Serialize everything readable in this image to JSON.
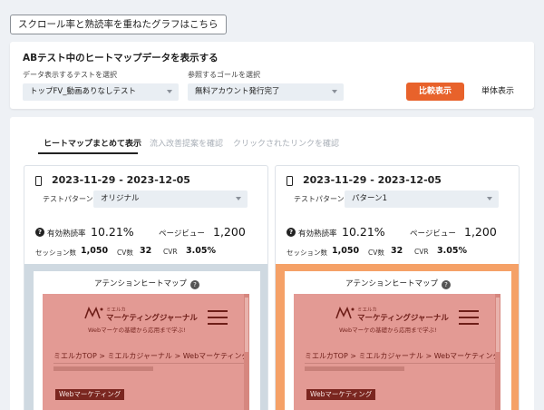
{
  "top_link": {
    "label": "スクロール率と熟読率を重ねたグラフはこちら"
  },
  "panel": {
    "title": "ABテスト中のヒートマップデータを表示する",
    "test_select_label": "データ表示するテストを選択",
    "test_select_value": "トップFV_動画ありなしテスト",
    "goal_select_label": "参照するゴールを選択",
    "goal_select_value": "無料アカウント発行完了",
    "compare_button": "比較表示",
    "single_button": "単体表示"
  },
  "tabs": [
    {
      "label": "ヒートマップまとめて表示",
      "active": true
    },
    {
      "label": "流入改善提案を確認",
      "active": false
    },
    {
      "label": "クリックされたリンクを確認",
      "active": false
    }
  ],
  "cards": [
    {
      "date_range": "2023-11-29 - 2023-12-05",
      "pattern_label": "テストパターン",
      "pattern_value": "オリジナル",
      "read_rate_label": "有効熟読率",
      "read_rate_value": "10.21%",
      "pageview_label": "ページビュー",
      "pageview_value": "1,200",
      "sessions_label": "セッション数",
      "sessions_value": "1,050",
      "cv_label": "CV数",
      "cv_value": "32",
      "cvr_label": "CVR",
      "cvr_value": "3.05%",
      "heatmap_title": "アテンションヒートマップ",
      "accent_color": "#cfd9e1"
    },
    {
      "date_range": "2023-11-29 - 2023-12-05",
      "pattern_label": "テストパターン",
      "pattern_value": "パターン1",
      "read_rate_label": "有効熟読率",
      "read_rate_value": "10.21%",
      "pageview_label": "ページビュー",
      "pageview_value": "1,200",
      "sessions_label": "セッション数",
      "sessions_value": "1,050",
      "cv_label": "CV数",
      "cv_value": "32",
      "cvr_label": "CVR",
      "cvr_value": "3.05%",
      "heatmap_title": "アテンションヒートマップ",
      "accent_color": "#f5a167"
    }
  ],
  "preview": {
    "logo_small": "ミエルカ",
    "logo_text": "マーケティングジャーナル",
    "logo_sub": "Webマーケの基礎から応用まで学ぶ!",
    "breadcrumb": "ミエルカTOP > ミエルカジャーナル > Webマーケティング",
    "tag": "Webマーケティング",
    "heat_color": "#e39a94"
  },
  "icons": {
    "device": "smartphone-icon",
    "help": "question-circle-icon",
    "menu": "hamburger-icon",
    "dropdown": "chevron-down-icon"
  }
}
